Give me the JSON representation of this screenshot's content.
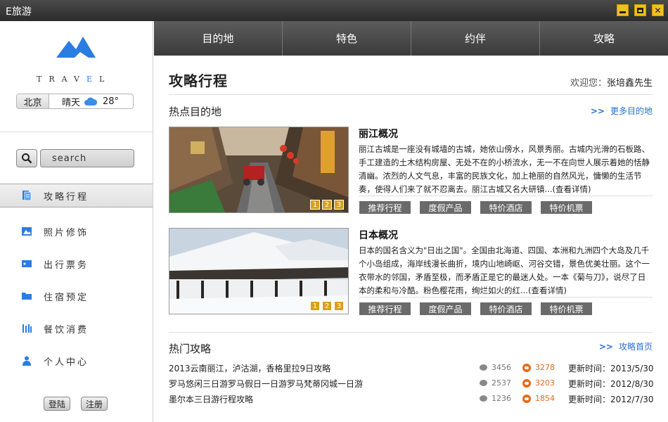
{
  "window": {
    "title": "E旅游",
    "minimize": "–",
    "close": "✕"
  },
  "weather": {
    "city": "北京",
    "condition": "晴天",
    "temperature": "28°",
    "icon": "cloud-icon"
  },
  "logo": {
    "text_pre": "TRAV",
    "text_accent": "E",
    "text_post": "L",
    "brand_color": "#2a7de1"
  },
  "search": {
    "placeholder": "search"
  },
  "sidebar": {
    "items": [
      {
        "label": "攻略行程",
        "icon": "document-icon"
      },
      {
        "label": "照片修饰",
        "icon": "image-icon"
      },
      {
        "label": "出行票务",
        "icon": "ticket-icon"
      },
      {
        "label": "住宿预定",
        "icon": "folder-icon"
      },
      {
        "label": "餐饮消费",
        "icon": "bars-icon"
      },
      {
        "label": "个人中心",
        "icon": "user-icon"
      }
    ],
    "login": "登陆",
    "register": "注册"
  },
  "tabs": [
    "目的地",
    "特色",
    "约伴",
    "攻略"
  ],
  "main": {
    "title": "攻略行程",
    "welcome_prefix": "欢迎您：",
    "user_name": "张培鑫先生",
    "hot_destinations": {
      "title": "热点目的地",
      "more": "更多目的地"
    },
    "destinations": [
      {
        "name": "丽江概况",
        "description": "丽江古城是一座没有城墙的古城，她依山傍水，风景秀丽。古城内光滑的石板路、手工建造的土木结构房屋、无处不在的小桥流水，无一不在向世人展示着她的恬静清幽。浓烈的人文气息，丰富的民族文化，加上艳丽的自然风光，慵懒的生活节奏，使得人们来了就不忍离去。丽江古城又名大研镇",
        "detail": "...(查看详情)",
        "pager": [
          "1",
          "2",
          "3"
        ],
        "tags": [
          "推荐行程",
          "度假产品",
          "特价酒店",
          "特价机票"
        ]
      },
      {
        "name": "日本概况",
        "description": "日本的国名含义为\"日出之国\"。全国由北海道、四国、本洲和九洲四个大岛及几千个小岛组成，海岸线漫长曲折，境内山地崎岖、河谷交错，景色优美壮丽。这个一衣带水的邻国，矛盾至极，而矛盾正是它的最迷人处。一本《菊与刀》，说尽了日本的柔和与冷酷。粉色樱花雨，绚烂如火的红",
        "detail": "...(查看详情)",
        "pager": [
          "1",
          "2",
          "3"
        ],
        "tags": [
          "推荐行程",
          "度假产品",
          "特价酒店",
          "特价机票"
        ]
      }
    ],
    "hot_guides": {
      "title": "热门攻略",
      "more": "攻略首页",
      "items": [
        {
          "title": "2013云南丽江，泸沽湖，香格里拉9日攻略",
          "views": "3456",
          "likes": "3278",
          "updated": "更新时间：2013/5/30"
        },
        {
          "title": "罗马悠闲三日游罗马假日一日游罗马梵蒂冈城一日游",
          "views": "2537",
          "likes": "3203",
          "updated": "更新时间：2012/8/30"
        },
        {
          "title": "墨尔本三日游行程攻略",
          "views": "1236",
          "likes": "1854",
          "updated": "更新时间：2012/7/30"
        }
      ]
    }
  }
}
